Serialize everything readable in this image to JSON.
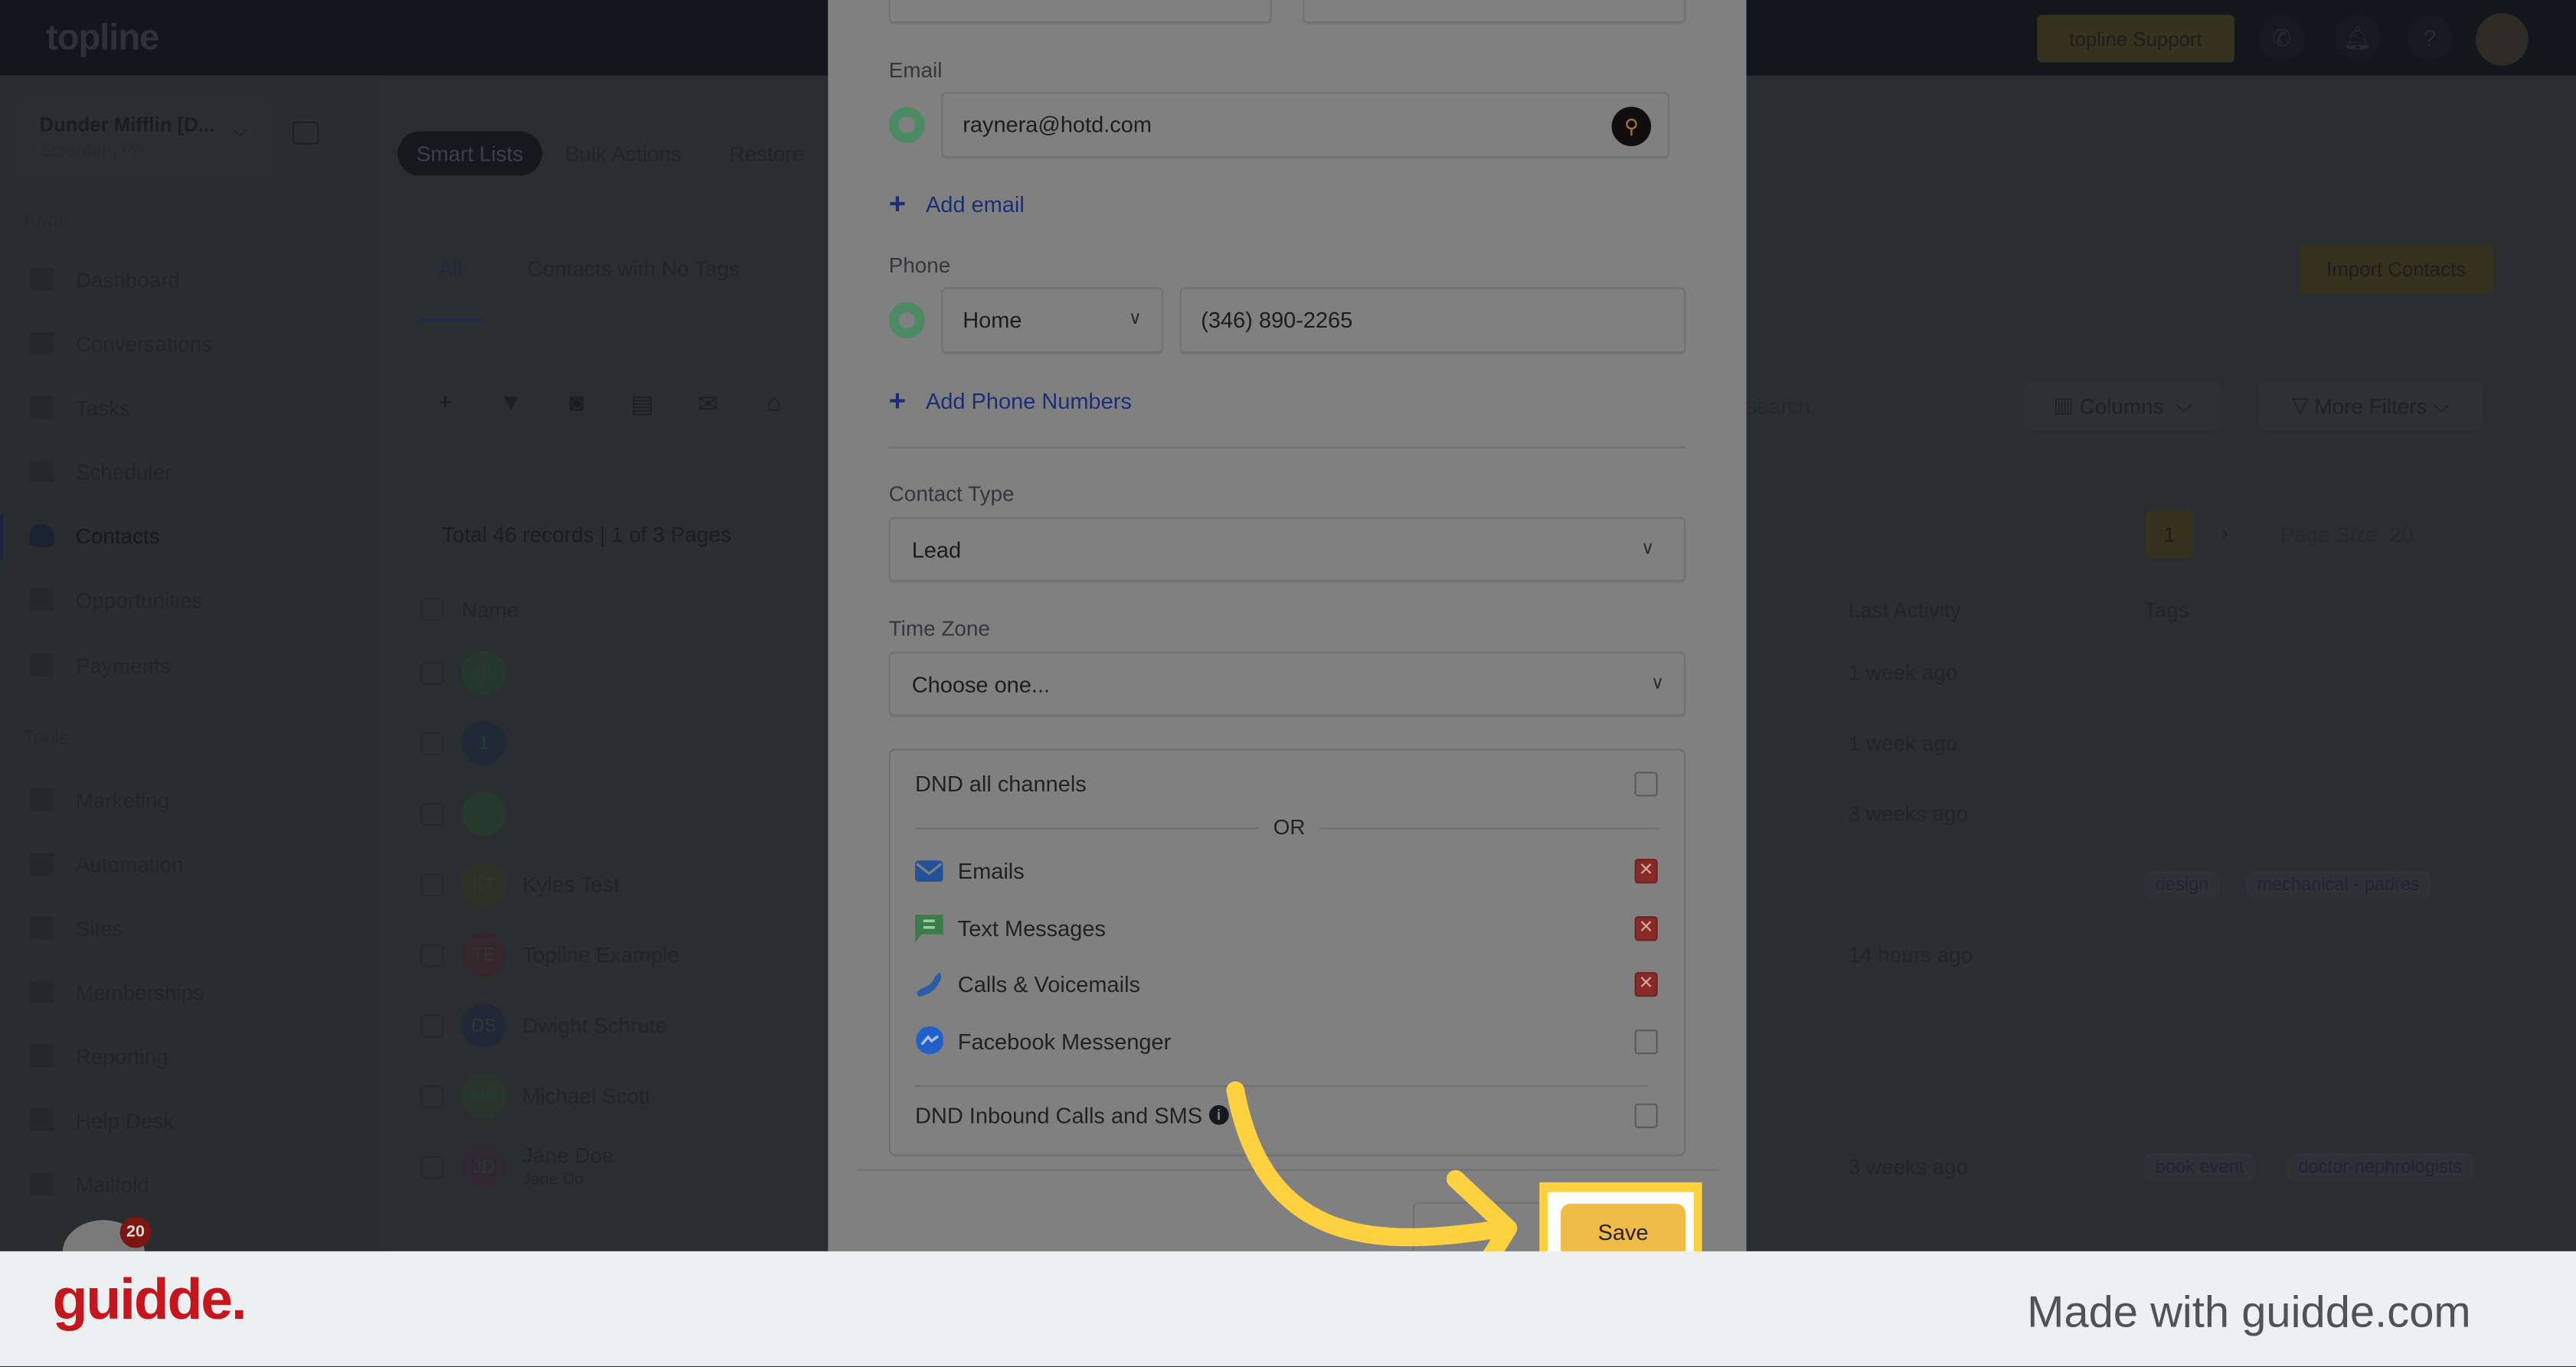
{
  "topbar": {
    "logo": "topline",
    "support_label": "topline Support",
    "icons": [
      "phone-icon",
      "bell-icon",
      "help-icon",
      "avatar"
    ]
  },
  "sidebar": {
    "account_name": "Dunder Mifflin [D...",
    "account_location": "Scranton, PA",
    "apps_label": "Apps",
    "tools_label": "Tools",
    "apps": [
      {
        "label": "Dashboard"
      },
      {
        "label": "Conversations"
      },
      {
        "label": "Tasks"
      },
      {
        "label": "Scheduler"
      },
      {
        "label": "Contacts",
        "active": true
      },
      {
        "label": "Opportunities"
      },
      {
        "label": "Payments"
      }
    ],
    "tools": [
      {
        "label": "Marketing"
      },
      {
        "label": "Automation"
      },
      {
        "label": "Sites"
      },
      {
        "label": "Memberships"
      },
      {
        "label": "Reporting"
      },
      {
        "label": "Help Desk"
      },
      {
        "label": "Mailfold"
      }
    ],
    "notification_count": "20"
  },
  "main": {
    "top_tabs": [
      "Smart Lists",
      "Bulk Actions",
      "Restore"
    ],
    "list_tabs": [
      "All",
      "Contacts with No Tags"
    ],
    "import_label": "Import Contacts",
    "search_placeholder": "search",
    "columns_label": "Columns",
    "more_filters_label": "More Filters",
    "records_summary": "Total 46 records | 1 of 3 Pages",
    "page_current": "1",
    "page_size": "Page Size: 20",
    "headers": {
      "name": "Name",
      "last_activity": "Last Activity",
      "tags": "Tags"
    },
    "rows": [
      {
        "initials": "(8",
        "name": "",
        "activity": "1 week ago",
        "tags": [],
        "color": "#26382e"
      },
      {
        "initials": "1",
        "name": "",
        "activity": "1 week ago",
        "tags": [],
        "color": "#1f2a36"
      },
      {
        "initials": "(2",
        "name": "",
        "activity": "3 weeks ago",
        "tags": [],
        "color": "#263a2c"
      },
      {
        "initials": "KT",
        "name": "Kyles Test",
        "activity": "",
        "tags": [
          "design",
          "mechanical - padres"
        ],
        "color": "#2c3326"
      },
      {
        "initials": "TE",
        "name": "Topline Example",
        "activity": "14 hours ago",
        "tags": [],
        "color": "#34262a"
      },
      {
        "initials": "DS",
        "name": "Dwight Schrute",
        "activity": "",
        "tags": [],
        "color": "#212838"
      },
      {
        "initials": "MS",
        "name": "Michael Scott",
        "activity": "",
        "tags": [],
        "color": "#28362b"
      },
      {
        "initials": "JD",
        "name": "Jane Doe",
        "sub": "Jane Do",
        "activity": "3 weeks ago",
        "tags": [
          "book event",
          "doctor-nephrologists"
        ],
        "color": "#2f2830"
      }
    ]
  },
  "modal": {
    "email_label": "Email",
    "email_value": "raynera@hotd.com",
    "add_email": "Add email",
    "phone_label": "Phone",
    "phone_type": "Home",
    "phone_value": "(346) 890-2265",
    "add_phone": "Add Phone Numbers",
    "contact_type_label": "Contact Type",
    "contact_type_value": "Lead",
    "time_zone_label": "Time Zone",
    "time_zone_value": "Choose one...",
    "dnd_all_label": "DND all channels",
    "or_label": "OR",
    "channels": [
      {
        "label": "Emails",
        "icon": "envelope-icon",
        "checked": true
      },
      {
        "label": "Text Messages",
        "icon": "sms-icon",
        "checked": true
      },
      {
        "label": "Calls & Voicemails",
        "icon": "phone-icon",
        "checked": true
      },
      {
        "label": "Facebook Messenger",
        "icon": "messenger-icon",
        "checked": false
      }
    ],
    "dnd_inbound_label": "DND Inbound Calls and SMS",
    "save_label": "Save"
  },
  "colors": {
    "highlight": "#fdd13f",
    "save_button": "#f0bc48",
    "brand_red": "#c4161c"
  },
  "footer": {
    "brand": "guidde.",
    "tagline": "Made with guidde.com"
  }
}
